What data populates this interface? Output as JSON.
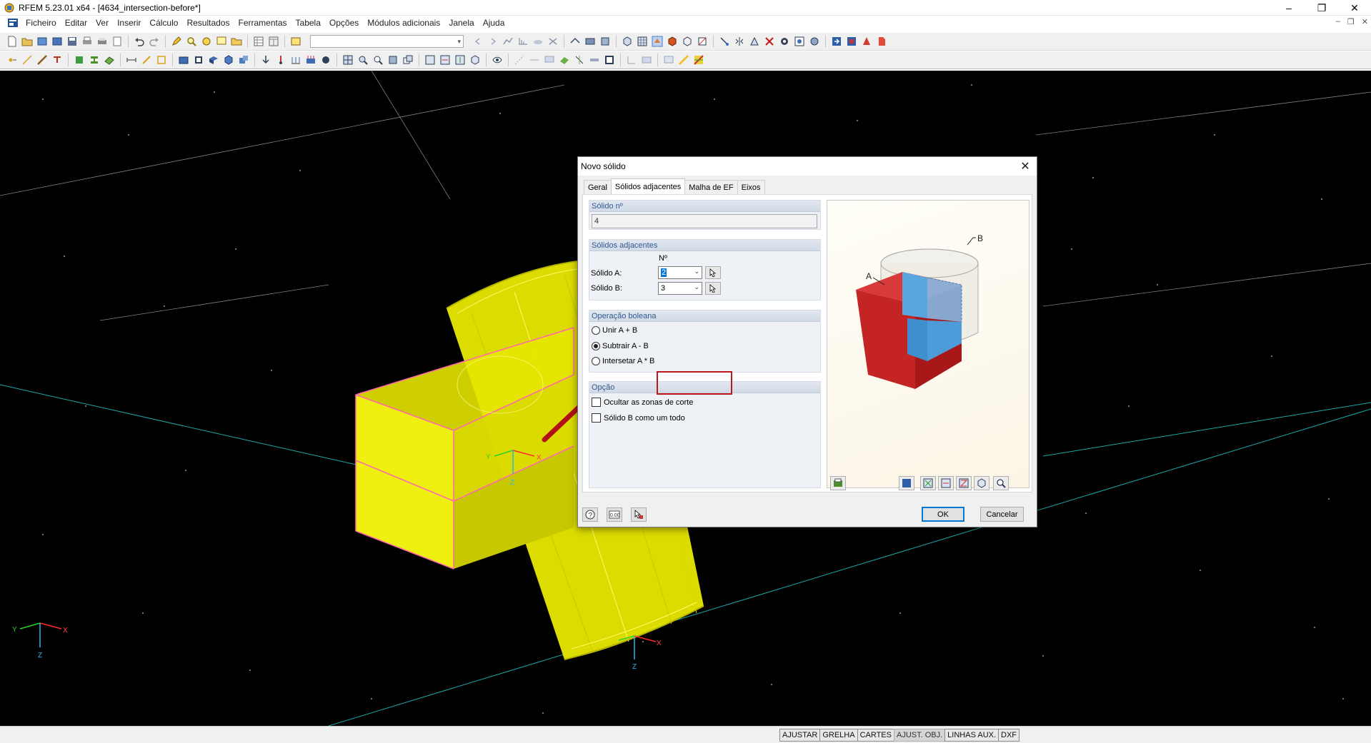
{
  "window": {
    "title": "RFEM 5.23.01 x64 - [4634_intersection-before*]"
  },
  "menu": [
    "Ficheiro",
    "Editar",
    "Ver",
    "Inserir",
    "Cálculo",
    "Resultados",
    "Ferramentas",
    "Tabela",
    "Opções",
    "Módulos adicionais",
    "Janela",
    "Ajuda"
  ],
  "viewport": {
    "axes_main": {
      "x": "X",
      "y": "Y",
      "z": "Z"
    },
    "axes_origin": {
      "x": "X",
      "y": "Y",
      "z": "Z"
    },
    "axes_lower": {
      "x": "X",
      "z": "Z"
    },
    "colors": {
      "background": "#000000",
      "solid": "#f0f000",
      "edge": "#ff6aa8",
      "grid": "#1fa7a7"
    }
  },
  "statusbar": {
    "buttons": [
      "AJUSTAR",
      "GRELHA",
      "CARTES",
      "AJUST. OBJ.",
      "LINHAS AUX.",
      "DXF"
    ]
  },
  "dialog": {
    "title": "Novo sólido",
    "tabs": [
      "Geral",
      "Sólidos adjacentes",
      "Malha de EF",
      "Eixos"
    ],
    "active_tab": "Sólidos adjacentes",
    "solid_no": {
      "header": "Sólido nº",
      "value": "4"
    },
    "adjacent": {
      "header": "Sólidos adjacentes",
      "col_header": "Nº",
      "solid_a_label": "Sólido A:",
      "solid_a_value": "2",
      "solid_b_label": "Sólido B:",
      "solid_b_value": "3"
    },
    "boolean": {
      "header": "Operação boleana",
      "options": [
        "Unir A + B",
        "Subtrair A - B",
        "Intersetar A * B"
      ],
      "selected": "Subtrair A - B"
    },
    "option": {
      "header": "Opção",
      "checks": [
        {
          "label": "Ocultar as zonas de corte",
          "checked": false
        },
        {
          "label": "Sólido B como um todo",
          "checked": false
        }
      ]
    },
    "preview": {
      "label_a": "A",
      "label_b": "B"
    },
    "buttons": {
      "ok": "OK",
      "cancel": "Cancelar"
    },
    "highlight_color": "#c0161c"
  }
}
